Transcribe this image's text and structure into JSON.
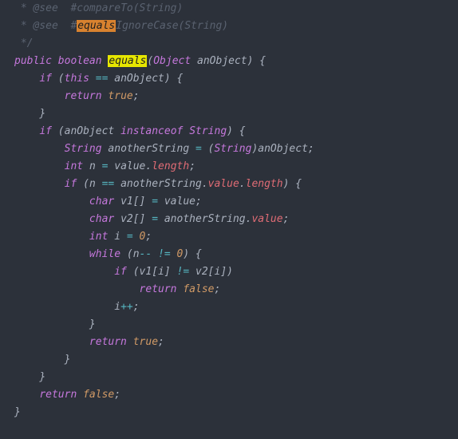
{
  "code": {
    "c1a": " * @see  #",
    "c1b": "compareTo(String)",
    "c2a": " * @see  #",
    "c2hl": "equals",
    "c2b": "IgnoreCase(String)",
    "c3": " */",
    "kw_public": "public",
    "kw_boolean": "boolean",
    "m_equals": "equals",
    "ty_object": "Object",
    "p_anObject": "anObject",
    "kw_if": "if",
    "kw_this": "this",
    "op_eqeq": "==",
    "kw_return": "return",
    "bl_true": "true",
    "kw_instanceof": "instanceof",
    "ty_string": "String",
    "v_anotherString": "anotherString",
    "op_eq": "=",
    "kw_int": "int",
    "v_n": "n",
    "v_value": "value",
    "v_length": "length",
    "kw_char": "char",
    "v_v1": "v1",
    "v_v2": "v2",
    "v_i": "i",
    "nm_0": "0",
    "kw_while": "while",
    "op_dec": "--",
    "op_ne": "!=",
    "op_inc": "++",
    "bl_false": "false"
  }
}
